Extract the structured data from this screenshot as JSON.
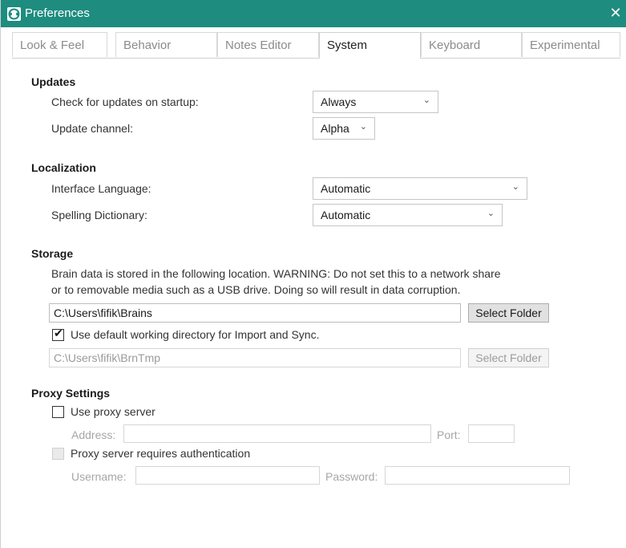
{
  "window": {
    "title": "Preferences",
    "close_glyph": "✕"
  },
  "tabs": [
    {
      "label": "Look & Feel"
    },
    {
      "label": "Behavior"
    },
    {
      "label": "Notes Editor"
    },
    {
      "label": "System",
      "active": true
    },
    {
      "label": "Keyboard"
    },
    {
      "label": "Experimental"
    }
  ],
  "updates": {
    "title": "Updates",
    "check_label": "Check for updates on startup:",
    "check_value": "Always",
    "channel_label": "Update channel:",
    "channel_value": "Alpha"
  },
  "localization": {
    "title": "Localization",
    "interface_label": "Interface Language:",
    "interface_value": "Automatic",
    "spelling_label": "Spelling Dictionary:",
    "spelling_value": "Automatic"
  },
  "storage": {
    "title": "Storage",
    "warning_line1": "Brain data is stored in the following location. WARNING: Do not set this to a network share",
    "warning_line2": "or to removable media such as a USB drive. Doing so will result in data corruption.",
    "path_value": "C:\\Users\\fifik\\Brains",
    "select_folder_label": "Select Folder",
    "default_dir_label": "Use default working directory for Import and Sync.",
    "default_dir_checked": true,
    "tmp_path_value": "C:\\Users\\fifik\\BrnTmp",
    "select_folder2_label": "Select Folder"
  },
  "proxy": {
    "title": "Proxy Settings",
    "use_proxy_label": "Use proxy server",
    "use_proxy_checked": false,
    "address_label": "Address:",
    "port_label": "Port:",
    "auth_label": "Proxy server requires authentication",
    "username_label": "Username:",
    "password_label": "Password:"
  },
  "icons": {
    "dropdown": "chevron-down-icon",
    "app": "app-logo-icon",
    "close": "close-icon",
    "check": "checkmark-icon"
  },
  "colors": {
    "titlebar": "#1e8c7f"
  }
}
